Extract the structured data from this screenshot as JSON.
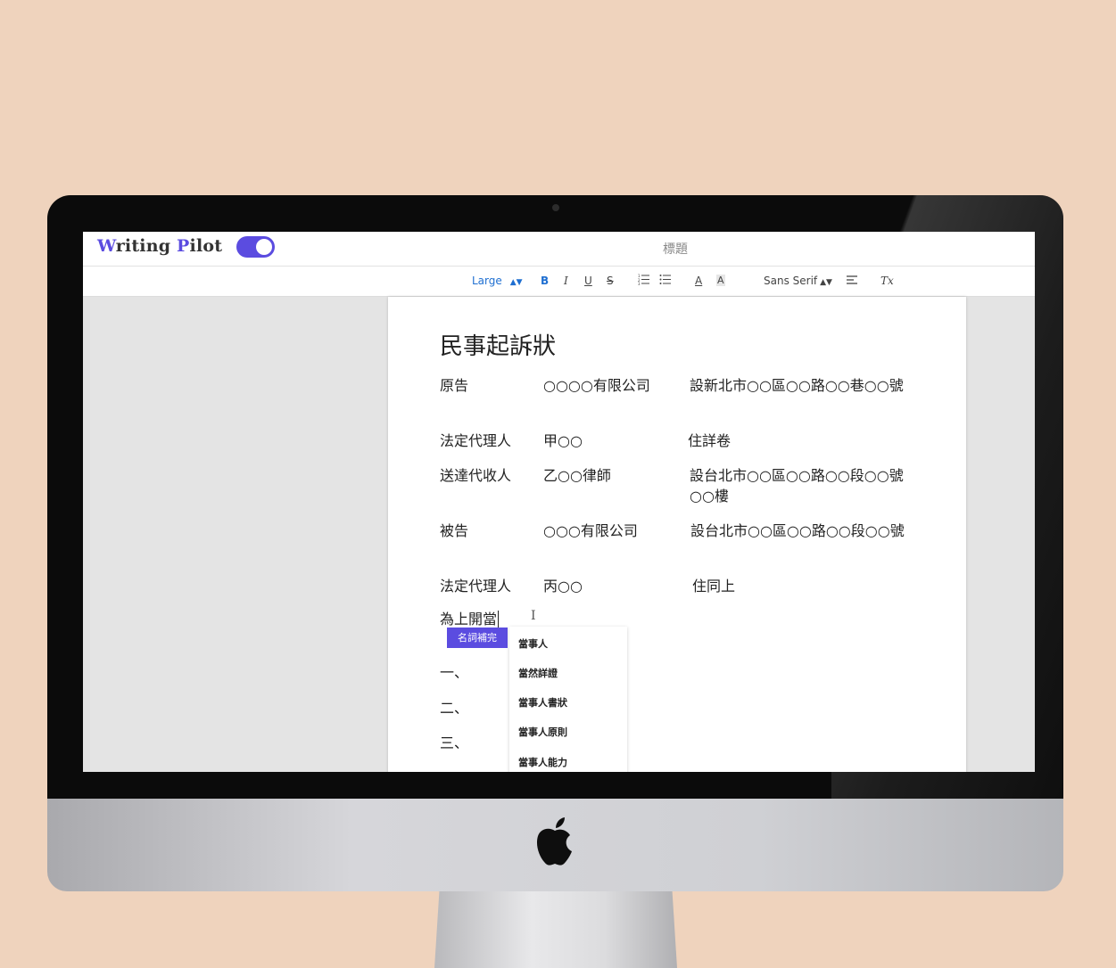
{
  "app": {
    "name_part1": "W",
    "name_part2": "riting ",
    "name_part3": "P",
    "name_part4": "ilot",
    "toggle_on": true,
    "document_title": "標題"
  },
  "toolbar": {
    "size_select": "Large",
    "bold": "B",
    "italic": "I",
    "underline": "U",
    "strike": "S",
    "ordered_list_icon": "ordered-list-icon",
    "bullet_list_icon": "bullet-list-icon",
    "font_color_label": "A",
    "highlight_label": "A",
    "font_select": "Sans Serif",
    "align_icon": "align-icon",
    "clear_format_label": "Tx"
  },
  "document": {
    "heading": "民事起訴狀",
    "rows": [
      {
        "role": "原告",
        "name": "○○○○有限公司",
        "address": "設新北市○○區○○路○○巷○○號"
      },
      {
        "role": "法定代理人",
        "name": "甲○○",
        "address": "住詳卷"
      },
      {
        "role": "送達代收人",
        "name": "乙○○律師",
        "address": "設台北市○○區○○路○○段○○號○○樓"
      },
      {
        "role": "被告",
        "name": "○○○有限公司",
        "address": "設台北市○○區○○路○○段○○號"
      },
      {
        "role": "法定代理人",
        "name": "丙○○",
        "address": "住同上"
      }
    ],
    "typing_line": "為上開當",
    "list_markers": [
      "一、",
      "二、",
      "三、"
    ]
  },
  "autocomplete": {
    "tag": "名詞補完",
    "suggestions": [
      "當事人",
      "當然詳證",
      "當事人書狀",
      "當事人原則",
      "當事人能力"
    ]
  },
  "colors": {
    "accent": "#5b4ce0",
    "background": "#efd3bd",
    "size_select": "#1f6fd1"
  }
}
